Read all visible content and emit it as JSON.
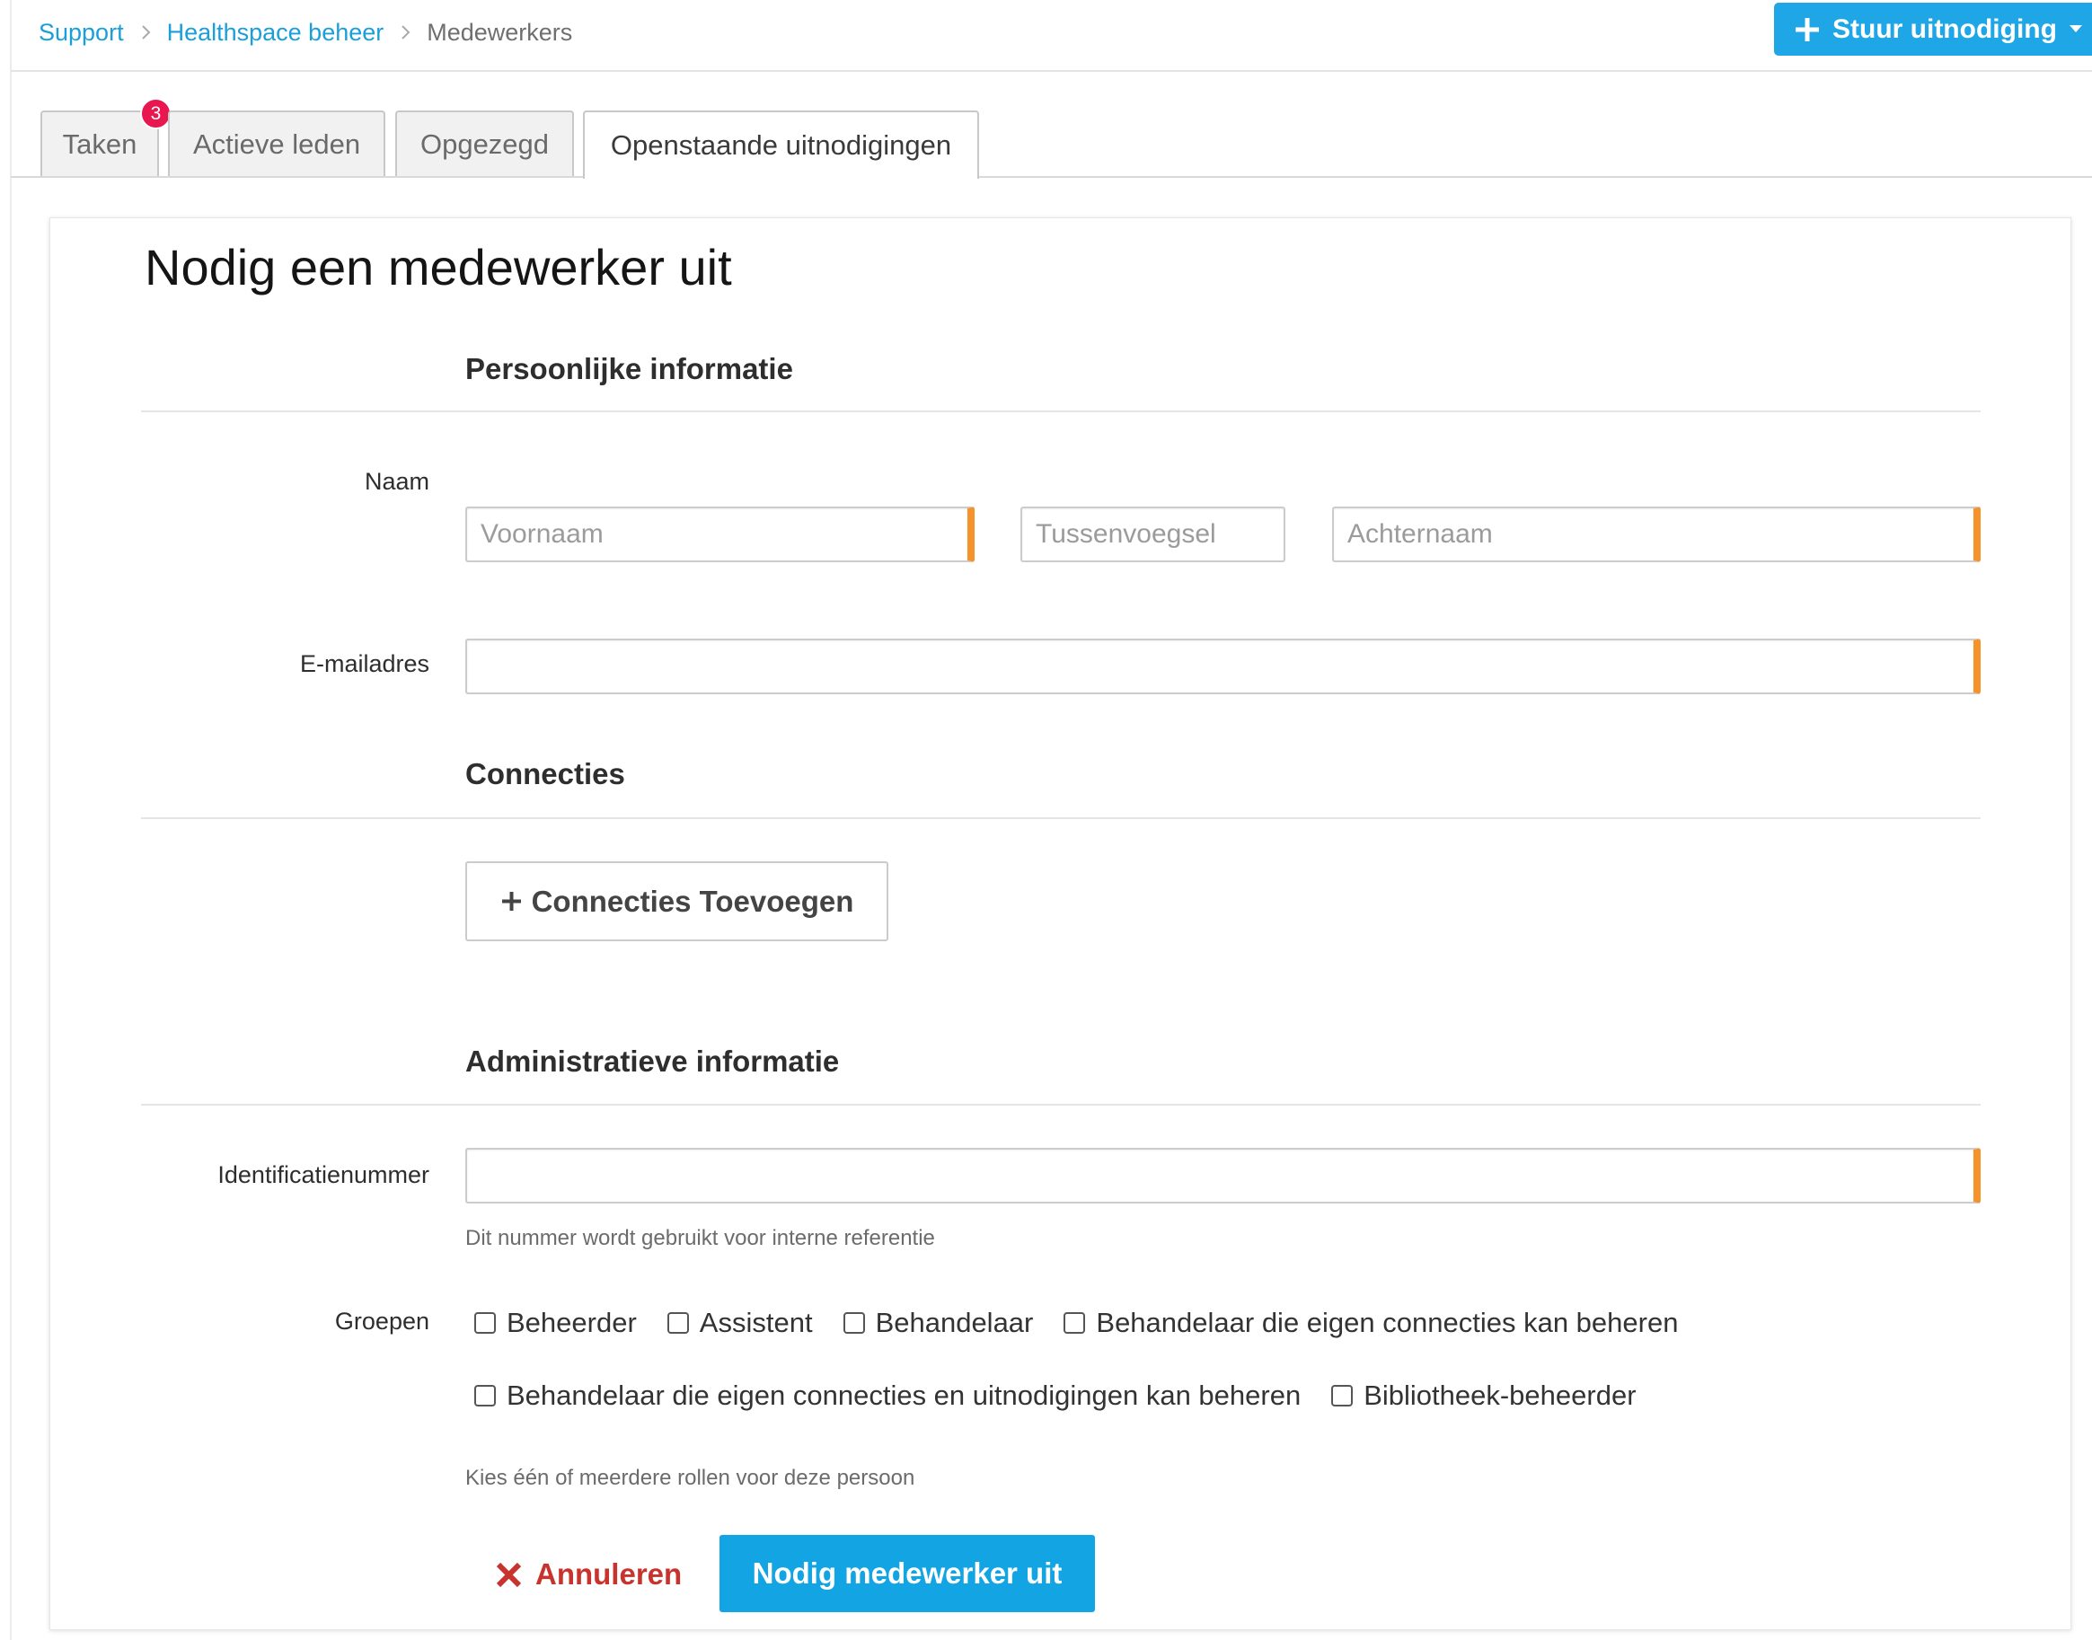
{
  "breadcrumb": {
    "separator_icon": "chevron-right-icon",
    "items": [
      {
        "label": "Support"
      },
      {
        "label": "Healthspace beheer"
      },
      {
        "label": "Medewerkers"
      }
    ]
  },
  "header": {
    "invite_button_label": "Stuur uitnodiging",
    "invite_button_icon": "plus-icon",
    "invite_dropdown_icon": "caret-down-icon"
  },
  "tabs": [
    {
      "label": "Taken",
      "badge": "3",
      "active": false
    },
    {
      "label": "Actieve leden",
      "active": false
    },
    {
      "label": "Opgezegd",
      "active": false
    },
    {
      "label": "Openstaande uitnodigingen",
      "active": true
    }
  ],
  "form": {
    "title": "Nodig een medewerker uit",
    "personal": {
      "heading": "Persoonlijke informatie",
      "name_label": "Naam",
      "first_name": {
        "placeholder": "Voornaam",
        "value": "",
        "required": true
      },
      "infix": {
        "placeholder": "Tussenvoegsel",
        "value": "",
        "required": false
      },
      "last_name": {
        "placeholder": "Achternaam",
        "value": "",
        "required": true
      },
      "email_label": "E-mailadres",
      "email": {
        "placeholder": "",
        "value": "",
        "required": true
      }
    },
    "connections": {
      "heading": "Connecties",
      "add_button_label": "Connecties Toevoegen",
      "add_button_icon": "plus-icon"
    },
    "administrative": {
      "heading": "Administratieve informatie",
      "id_label": "Identificatienummer",
      "id_field": {
        "placeholder": "",
        "value": "",
        "required": true
      },
      "id_help": "Dit nummer wordt gebruikt voor interne referentie",
      "groups_label": "Groepen",
      "groups": [
        {
          "label": "Beheerder",
          "checked": false
        },
        {
          "label": "Assistent",
          "checked": false
        },
        {
          "label": "Behandelaar",
          "checked": false
        },
        {
          "label": "Behandelaar die eigen connecties kan beheren",
          "checked": false
        },
        {
          "label": "Behandelaar die eigen connecties en uitnodigingen kan beheren",
          "checked": false
        },
        {
          "label": "Bibliotheek-beheerder",
          "checked": false
        }
      ],
      "groups_help": "Kies één of meerdere rollen voor deze persoon"
    },
    "actions": {
      "cancel_label": "Annuleren",
      "cancel_icon": "close-icon",
      "submit_label": "Nodig medewerker uit"
    }
  },
  "colors": {
    "link": "#1a9fd9",
    "primary_button": "#1ea6e6",
    "submit_button": "#13a4e3",
    "required_indicator": "#f6922a",
    "danger": "#c9332d",
    "badge": "#e8174f"
  }
}
